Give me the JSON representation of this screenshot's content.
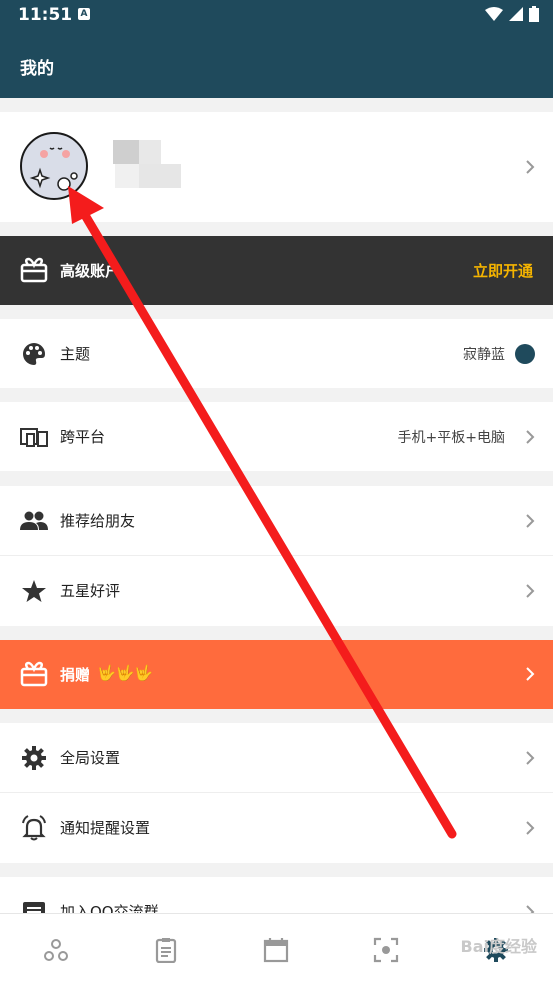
{
  "status_bar": {
    "time": "11:51",
    "badge": "A"
  },
  "app_bar": {
    "title": "我的"
  },
  "profile": {
    "username_blurred": true
  },
  "premium": {
    "label": "高级账户",
    "cta": "立即开通",
    "cta_color": "#f5b400"
  },
  "settings": {
    "theme": {
      "label": "主题",
      "value": "寂静蓝",
      "color": "#1f4a5c"
    },
    "cross_platform": {
      "label": "跨平台",
      "value": "手机+平板+电脑"
    },
    "recommend": {
      "label": "推荐给朋友"
    },
    "rate": {
      "label": "五星好评"
    },
    "donate": {
      "label": "捐赠",
      "emoji": "🤟🤟🤟",
      "color": "#ff6b3d"
    },
    "global_settings": {
      "label": "全局设置"
    },
    "notification": {
      "label": "通知提醒设置"
    },
    "qq_group": {
      "label": "加入QQ交流群"
    }
  },
  "bottom_nav": {
    "items": [
      "nodes-icon",
      "clipboard-icon",
      "calendar-icon",
      "focus-icon",
      "gear-icon"
    ],
    "active": "gear-icon"
  },
  "watermark": {
    "text": "Bai度经验"
  }
}
